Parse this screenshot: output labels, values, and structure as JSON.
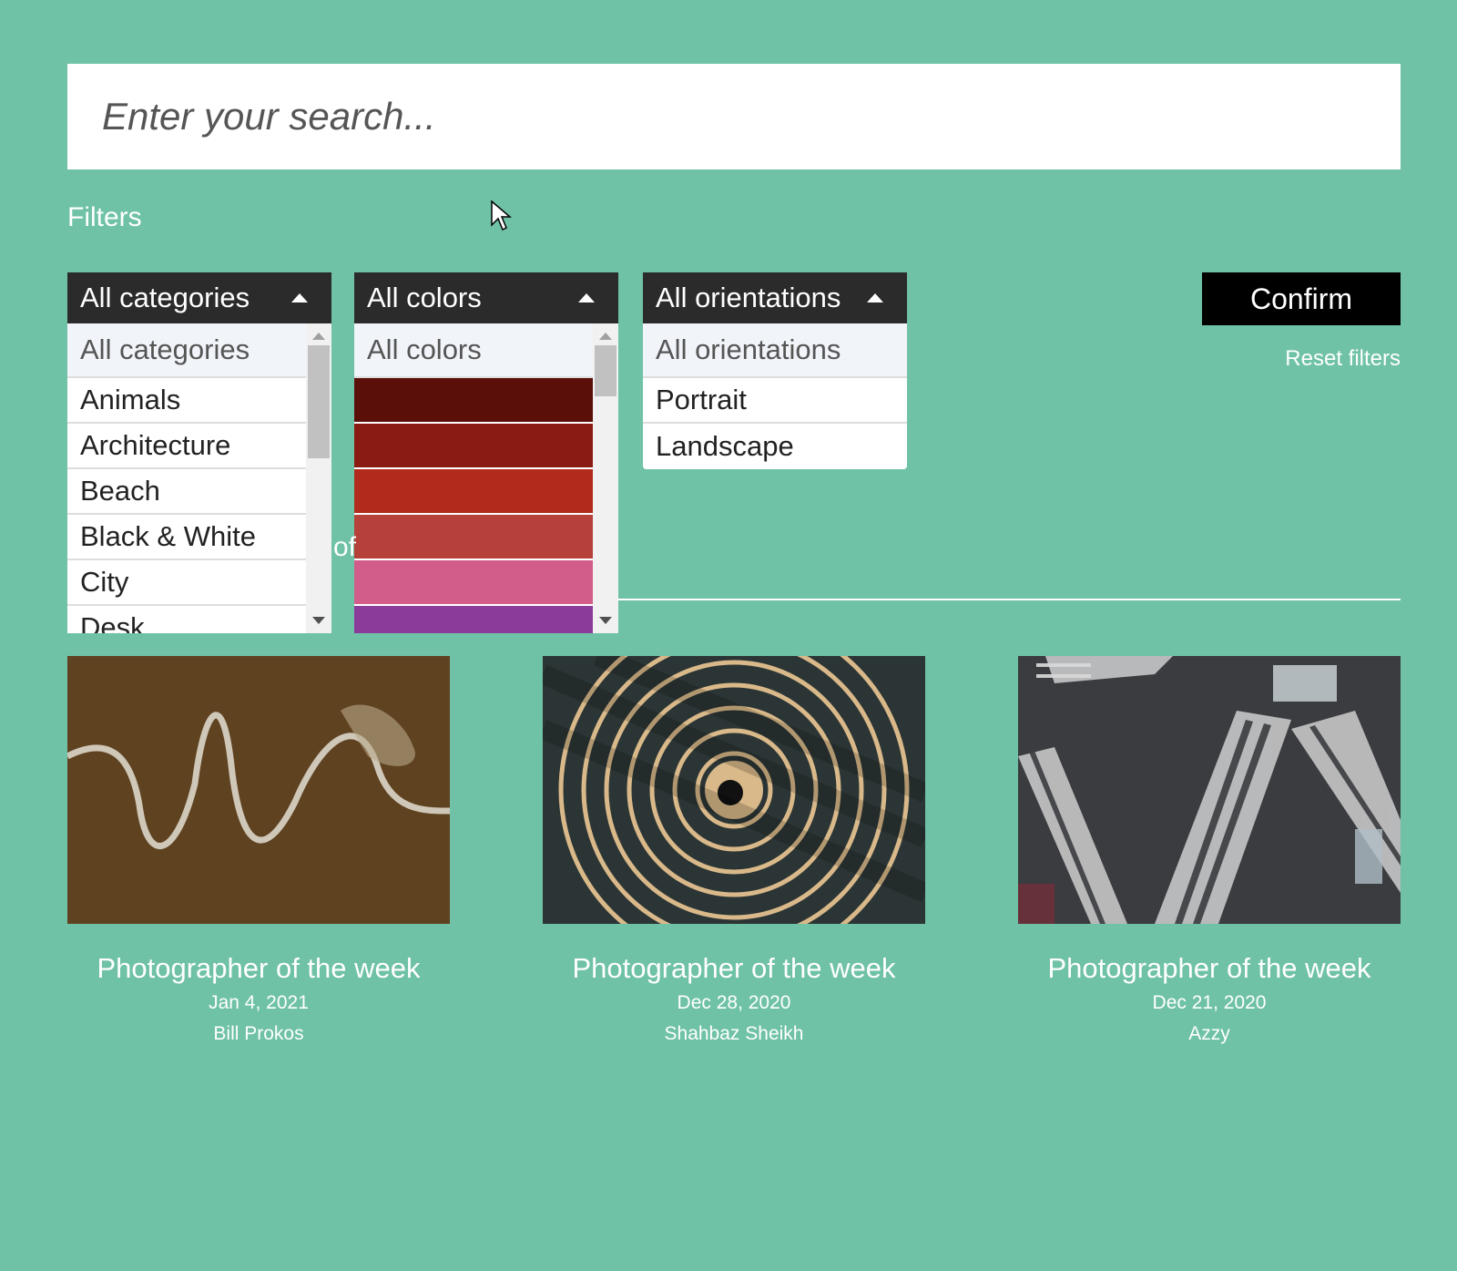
{
  "search": {
    "placeholder": "Enter your search..."
  },
  "filters": {
    "title": "Filters",
    "categories": {
      "header": "All categories",
      "items": [
        "All categories",
        "Animals",
        "Architecture",
        "Beach",
        "Black & White",
        "City",
        "Desk"
      ]
    },
    "colors": {
      "header": "All colors",
      "first_item": "All colors",
      "swatches": [
        "#5a0f08",
        "#8a1b12",
        "#b22a1c",
        "#b6403a",
        "#d25c8a",
        "#8b3c9a"
      ]
    },
    "orientations": {
      "header": "All orientations",
      "items": [
        "All orientations",
        "Portrait",
        "Landscape"
      ]
    },
    "confirm_label": "Confirm",
    "reset_label": "Reset filters"
  },
  "partial_text": "of",
  "cards": [
    {
      "title": "Photographer of the week",
      "date": "Jan 4, 2021",
      "author": "Bill Prokos"
    },
    {
      "title": "Photographer of the week",
      "date": "Dec 28, 2020",
      "author": "Shahbaz Sheikh"
    },
    {
      "title": "Photographer of the week",
      "date": "Dec 21, 2020",
      "author": "Azzy"
    }
  ],
  "colors": {
    "background": "#6fc2a5",
    "header_dark": "#2b2b2b"
  }
}
